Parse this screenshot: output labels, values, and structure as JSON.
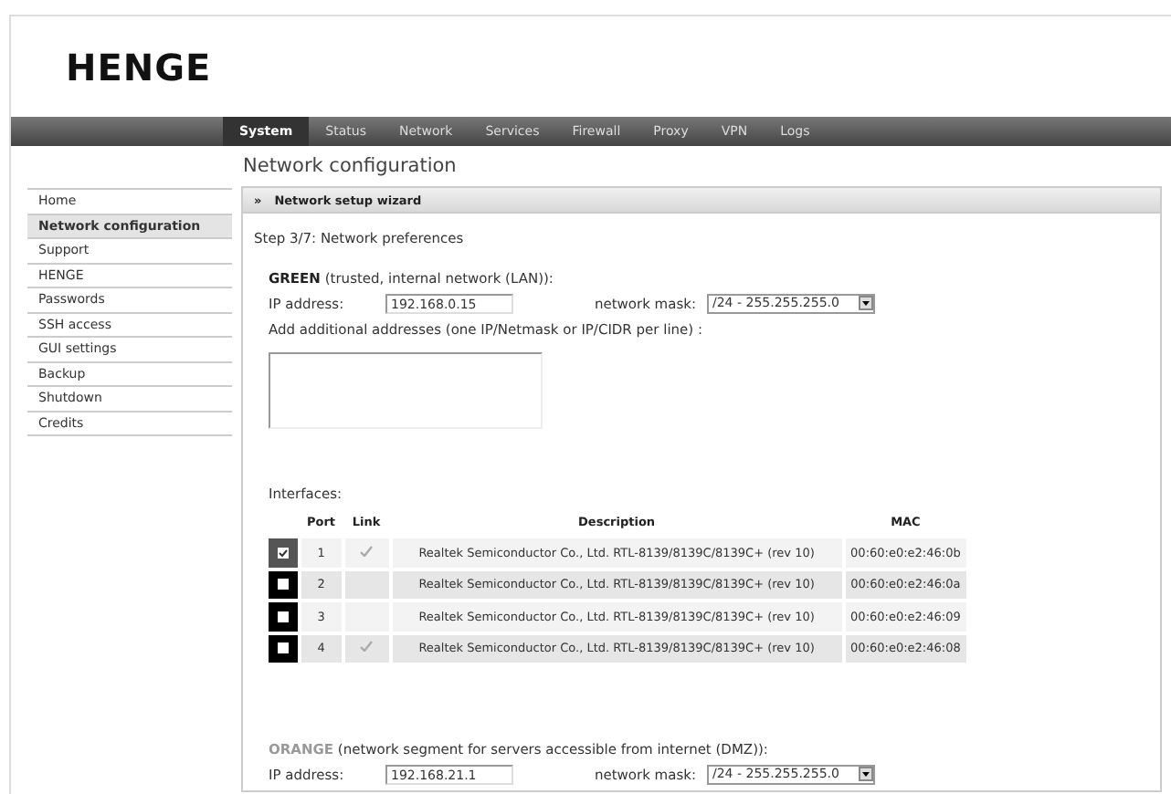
{
  "logo": "HENGE",
  "nav": [
    {
      "label": "System",
      "selected": true
    },
    {
      "label": "Status",
      "selected": false
    },
    {
      "label": "Network",
      "selected": false
    },
    {
      "label": "Services",
      "selected": false
    },
    {
      "label": "Firewall",
      "selected": false
    },
    {
      "label": "Proxy",
      "selected": false
    },
    {
      "label": "VPN",
      "selected": false
    },
    {
      "label": "Logs",
      "selected": false
    }
  ],
  "page_title": "Network configuration",
  "sidebar": [
    {
      "label": "Home",
      "selected": false
    },
    {
      "label": "Network configuration",
      "selected": true
    },
    {
      "label": "Support",
      "selected": false
    },
    {
      "label": "HENGE",
      "selected": false
    },
    {
      "label": "Passwords",
      "selected": false
    },
    {
      "label": "SSH access",
      "selected": false
    },
    {
      "label": "GUI settings",
      "selected": false
    },
    {
      "label": "Backup",
      "selected": false
    },
    {
      "label": "Shutdown",
      "selected": false
    },
    {
      "label": "Credits",
      "selected": false
    }
  ],
  "panel": {
    "marker": "»",
    "title": "Network setup wizard",
    "step": "Step 3/7: Network preferences",
    "green": {
      "name": "GREEN",
      "desc": "(trusted, internal network (LAN)):",
      "ip_label": "IP address:",
      "ip": "192.168.0.15",
      "mask_label": "network mask:",
      "mask": "/24 - 255.255.255.0",
      "extra_label": "Add additional addresses (one IP/Netmask or IP/CIDR per line) :"
    },
    "interfaces_label": "Interfaces:",
    "columns": [
      "Port",
      "Link",
      "Description",
      "MAC"
    ],
    "rows": [
      {
        "checked": true,
        "port": "1",
        "link": true,
        "description": "Realtek Semiconductor Co., Ltd. RTL-8139/8139C/8139C+ (rev 10)",
        "mac": "00:60:e0:e2:46:0b"
      },
      {
        "checked": false,
        "port": "2",
        "link": false,
        "description": "Realtek Semiconductor Co., Ltd. RTL-8139/8139C/8139C+ (rev 10)",
        "mac": "00:60:e0:e2:46:0a"
      },
      {
        "checked": false,
        "port": "3",
        "link": false,
        "description": "Realtek Semiconductor Co., Ltd. RTL-8139/8139C/8139C+ (rev 10)",
        "mac": "00:60:e0:e2:46:09"
      },
      {
        "checked": false,
        "port": "4",
        "link": true,
        "description": "Realtek Semiconductor Co., Ltd. RTL-8139/8139C/8139C+ (rev 10)",
        "mac": "00:60:e0:e2:46:08"
      }
    ],
    "orange": {
      "name": "ORANGE",
      "desc": "(network segment for servers accessible from internet (DMZ)):",
      "ip_label": "IP address:",
      "ip": "192.168.21.1",
      "mask_label": "network mask:",
      "mask": "/24 - 255.255.255.0"
    }
  }
}
